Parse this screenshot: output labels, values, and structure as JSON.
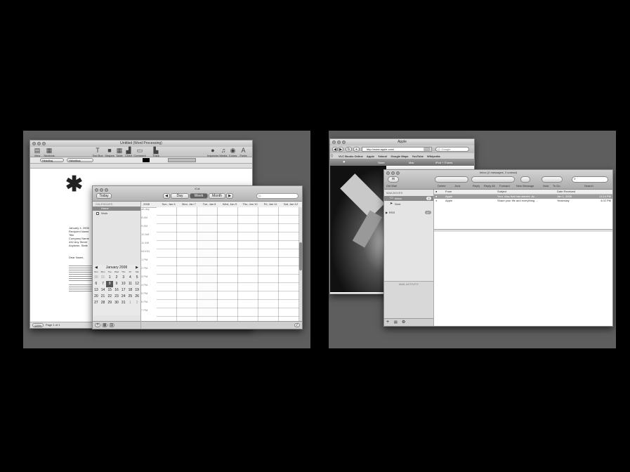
{
  "pages": {
    "left": {
      "pages_window": {
        "title": "Untitled (Word Processing)",
        "toolbar": [
          {
            "label": "View",
            "icon": "view-icon"
          },
          {
            "label": "Sections",
            "icon": "sections-icon"
          },
          {
            "label": "Text Box",
            "icon": "text-box-icon"
          },
          {
            "label": "Shapes",
            "icon": "shapes-icon"
          },
          {
            "label": "Table",
            "icon": "table-icon"
          },
          {
            "label": "Chart",
            "icon": "chart-icon"
          },
          {
            "label": "Comment",
            "icon": "comment-icon"
          },
          {
            "label": "Track Changes",
            "icon": "track-changes-icon"
          },
          {
            "label": "Inspector",
            "icon": "inspector-icon"
          },
          {
            "label": "Media",
            "icon": "media-icon"
          },
          {
            "label": "Colors",
            "icon": "colors-icon"
          },
          {
            "label": "Fonts",
            "icon": "fonts-icon"
          }
        ],
        "format_bar": {
          "style_value": "Heading",
          "font_value": "Helvetica"
        },
        "document_lines": [
          "January 4, 2008",
          "Recipient Name",
          "Title",
          "Company Name",
          "432 Any Street",
          "Anytown, State"
        ],
        "salutation": "Dear Name,",
        "status": {
          "zoom": "125%",
          "page": "Page 1 of 1"
        }
      },
      "ical_window": {
        "title": "iCal",
        "today_label": "Today",
        "view_tabs": [
          "Day",
          "Week",
          "Month"
        ],
        "search_placeholder": "Q-",
        "calendars_header": "CALENDARS",
        "calendars": [
          "Home",
          "Work"
        ],
        "week_year": "2008",
        "week_days": [
          "Sun, Jan 6",
          "Mon, Jan 7",
          "Tue, Jan 8",
          "Wed, Jan 9",
          "Thu, Jan 10",
          "Fri, Jan 11",
          "Sat, Jan 12"
        ],
        "time_labels": [
          "all-day",
          "8 AM",
          "9 AM",
          "10 AM",
          "11 AM",
          "NOON",
          "1 PM",
          "2 PM",
          "3 PM",
          "4 PM",
          "5 PM",
          "6 PM",
          "7 PM"
        ],
        "mini_month": "January 2008",
        "mini_days": [
          "Sun",
          "Mon",
          "Tue",
          "Wed",
          "Thu",
          "Fri",
          "Sat"
        ],
        "mini_dates": [
          [
            "30",
            "31",
            "1",
            "2",
            "3",
            "4",
            "5"
          ],
          [
            "6",
            "7",
            "8",
            "9",
            "10",
            "11",
            "12"
          ],
          [
            "13",
            "14",
            "15",
            "16",
            "17",
            "18",
            "19"
          ],
          [
            "20",
            "21",
            "22",
            "23",
            "24",
            "25",
            "26"
          ],
          [
            "27",
            "28",
            "29",
            "30",
            "31",
            "1",
            "2"
          ]
        ]
      }
    },
    "right": {
      "safari_window": {
        "title": "Apple",
        "url": "http://www.apple.com/",
        "search_placeholder": "Q- Google",
        "bookmarks": [
          "VLC Books Online",
          "Apple",
          "Yahoo!",
          "Google Maps",
          "YouTube",
          "Wikipedia"
        ],
        "nav_items": [
          "Store",
          "Mac",
          "iPod + iTunes"
        ]
      },
      "mail_window": {
        "title": "Inbox (2 messages, 2 unread)",
        "toolbar": [
          "Get Mail",
          "Delete",
          "Junk",
          "Reply",
          "Reply All",
          "Forward",
          "New Message",
          "Note",
          "To Do",
          "Search"
        ],
        "mailboxes_header": "MAILBOXES",
        "mailboxes": [
          {
            "name": "Inbox",
            "badge": "2"
          },
          {
            "name": "Sent",
            "badge": ""
          }
        ],
        "rss_label": "RSS",
        "rss_badge": "47",
        "activity_label": "MAIL ACTIVITY",
        "columns": [
          "From",
          "Subject",
          "Date Received"
        ],
        "messages": [
          {
            "from": "Apple",
            "subject": "Your .Mac trial has started. Ac…",
            "date": "Jan 1, 2008",
            "time": "11:14 PM"
          },
          {
            "from": "Apple",
            "subject": "Share your life and everything …",
            "date": "Yesterday",
            "time": "4:02 PM"
          }
        ]
      }
    }
  }
}
